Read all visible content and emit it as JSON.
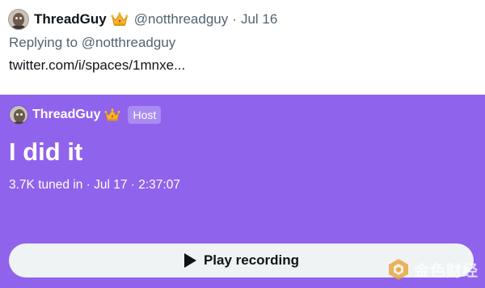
{
  "tweet": {
    "author_name": "ThreadGuy",
    "author_handle": "@notthreadguy",
    "separator": "·",
    "date": "Jul 16",
    "replying_prefix": "Replying to",
    "replying_to": "@notthreadguy",
    "link_text": "twitter.com/i/spaces/1mnxe..."
  },
  "space_card": {
    "host_name": "ThreadGuy",
    "host_badge": "Host",
    "title": "I did it",
    "meta": "3.7K tuned in · Jul 17 · 2:37:07",
    "play_button_label": "Play recording",
    "background_color": "#9063ec",
    "button_color": "#eff3f4"
  },
  "watermark": {
    "text": "金色财经"
  },
  "icons": {
    "avatar": "avatar-icon",
    "crown": "crown-icon",
    "play": "play-icon",
    "watermark_logo": "watermark-logo-icon"
  }
}
